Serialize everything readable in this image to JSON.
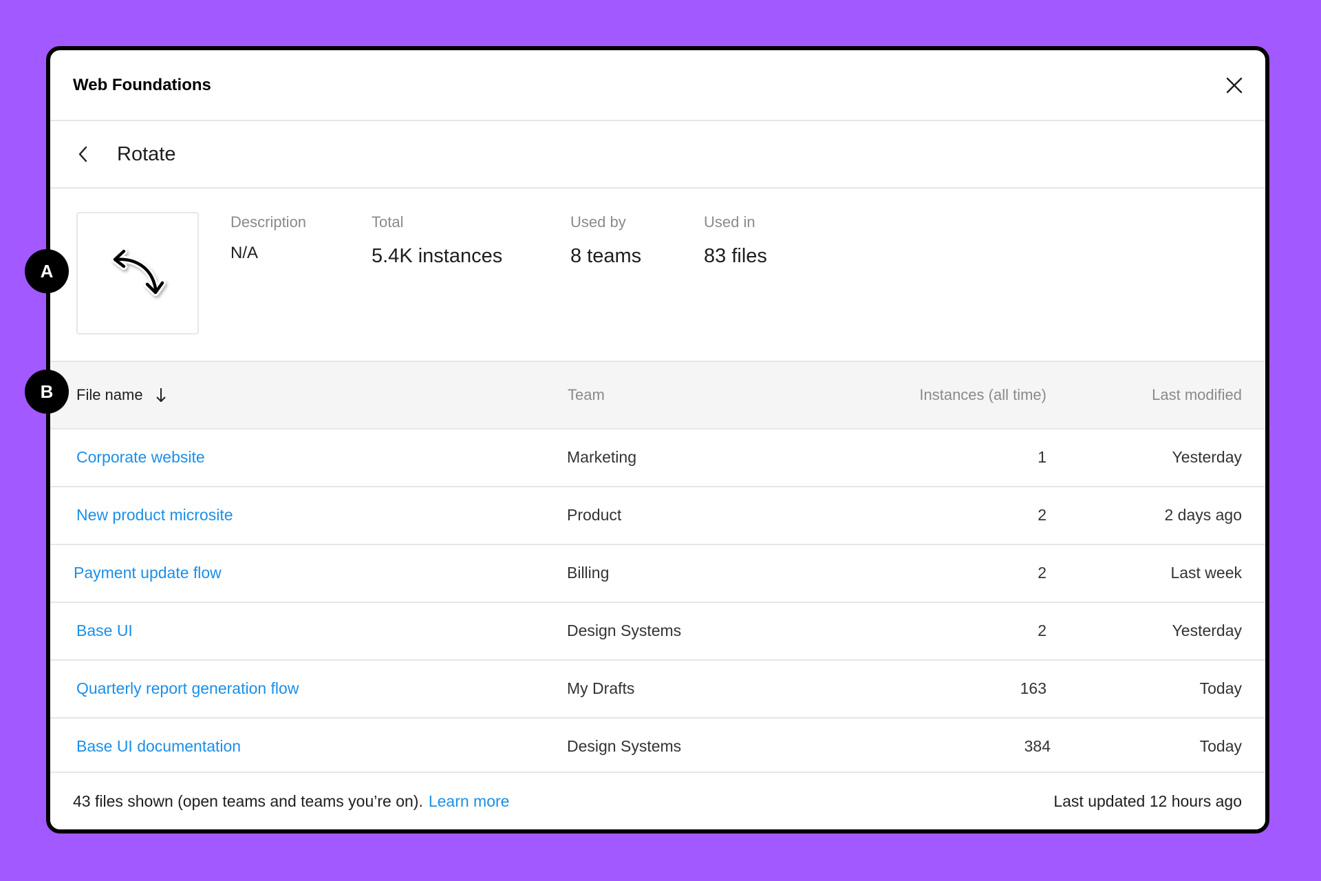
{
  "modal": {
    "title": "Web Foundations"
  },
  "subheader": {
    "title": "Rotate"
  },
  "icons": {
    "close": "close-icon",
    "back": "chevron-left-icon",
    "component": "rotate-arrow-icon",
    "sort": "arrow-down-icon"
  },
  "stats": {
    "description": {
      "label": "Description",
      "value": "N/A"
    },
    "total": {
      "label": "Total",
      "value": "5.4K instances"
    },
    "used_by": {
      "label": "Used by",
      "value": "8 teams"
    },
    "used_in": {
      "label": "Used in",
      "value": "83 files"
    }
  },
  "table": {
    "headers": {
      "file_name": "File name",
      "team": "Team",
      "instances": "Instances (all time)",
      "last_modified": "Last modified"
    },
    "rows": [
      {
        "file": "Corporate website",
        "team": "Marketing",
        "instances": "1",
        "modified": "Yesterday"
      },
      {
        "file": "New product microsite",
        "team": "Product",
        "instances": "2",
        "modified": "2 days ago"
      },
      {
        "file": "Payment update flow",
        "team": "Billing",
        "instances": "2",
        "modified": "Last week"
      },
      {
        "file": "Base UI",
        "team": "Design Systems",
        "instances": "2",
        "modified": "Yesterday"
      },
      {
        "file": "Quarterly report generation flow",
        "team": "My Drafts",
        "instances": "163",
        "modified": "Today"
      },
      {
        "file": "Base UI documentation",
        "team": "Design Systems",
        "instances": "384",
        "modified": "Today"
      }
    ]
  },
  "footer": {
    "summary": "43 files shown (open teams and teams you’re on).",
    "learn_more": "Learn more",
    "last_updated": "Last updated 12 hours ago"
  },
  "callouts": {
    "a": "A",
    "b": "B"
  },
  "colors": {
    "background": "#a259ff",
    "link": "#1b8fe8",
    "header_bg": "#f5f5f5"
  }
}
